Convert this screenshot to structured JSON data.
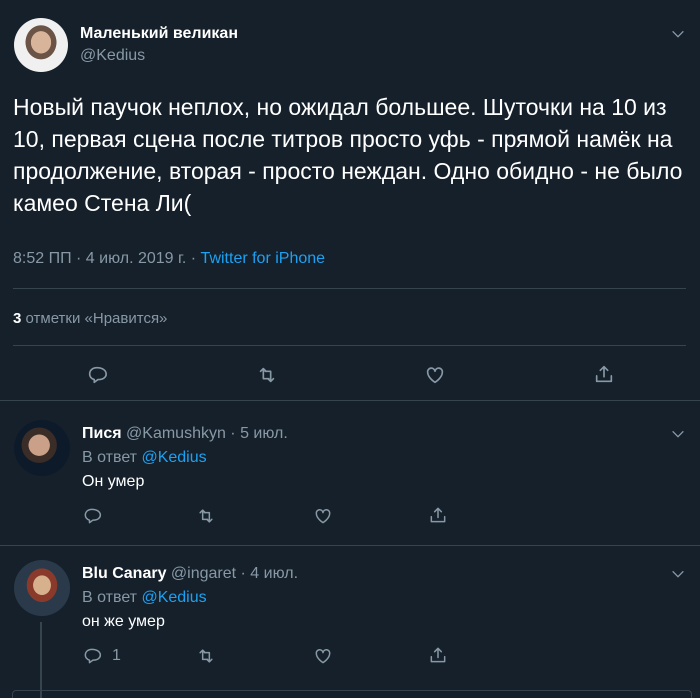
{
  "main_tweet": {
    "author_name": "Маленький великан",
    "author_handle": "@Kedius",
    "text": "Новый паучок неплох, но ожидал большее. Шуточки на 10 из 10, первая сцена после титров просто уфь - прямой намёк на продолжение, вторая - просто неждан. Одно обидно - не было камео Стена Ли(",
    "time": "8:52 ПП · 4 июл. 2019 г. · ",
    "source": "Twitter for iPhone",
    "likes_count": "3",
    "likes_label": " отметки «Нравится»"
  },
  "replies": [
    {
      "name": "Пися",
      "handle_date": " @Kamushkyn · 5 июл.",
      "reply_to_label": "В ответ ",
      "reply_to_mention": "@Kedius",
      "text": "Он умер",
      "reply_count": ""
    },
    {
      "name": "Blu Canary",
      "handle_date": " @ingaret · 4 июл.",
      "reply_to_label": "В ответ ",
      "reply_to_mention": "@Kedius",
      "text": "он же умер",
      "reply_count": "1"
    }
  ],
  "colors": {
    "background": "#15202b",
    "secondary_text": "#8899a6",
    "accent": "#1da1f2",
    "border": "#38444d"
  },
  "icons": [
    "reply-icon",
    "retweet-icon",
    "like-icon",
    "share-icon",
    "chevron-down-icon"
  ]
}
